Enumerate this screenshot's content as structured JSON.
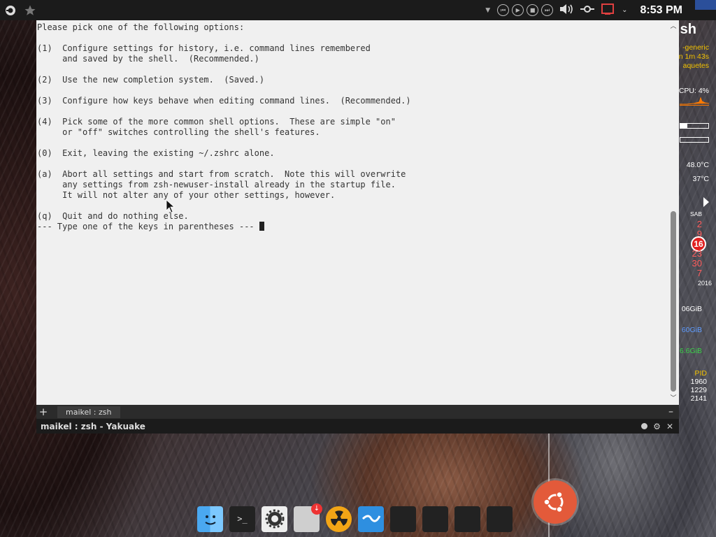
{
  "top_panel": {
    "clock": "8:53 PM",
    "icons_left": [
      "app-launcher-icon",
      "favorites-star-icon"
    ],
    "icons_right": [
      "dropdown-icon",
      "previous-track-icon",
      "play-icon",
      "stop-icon",
      "next-track-icon",
      "volume-icon",
      "network-icon",
      "notification-icon",
      "chevron-down-icon"
    ]
  },
  "terminal": {
    "lines": [
      "Please pick one of the following options:",
      "",
      "(1)  Configure settings for history, i.e. command lines remembered",
      "     and saved by the shell.  (Recommended.)",
      "",
      "(2)  Use the new completion system.  (Saved.)",
      "",
      "(3)  Configure how keys behave when editing command lines.  (Recommended.)",
      "",
      "(4)  Pick some of the more common shell options.  These are simple \"on\"",
      "     or \"off\" switches controlling the shell's features.",
      "",
      "(0)  Exit, leaving the existing ~/.zshrc alone.",
      "",
      "(a)  Abort all settings and start from scratch.  Note this will overwrite",
      "     any settings from zsh-newuser-install already in the startup file.",
      "     It will not alter any of your other settings, however.",
      "",
      "(q)  Quit and do nothing else.",
      "--- Type one of the keys in parentheses --- "
    ]
  },
  "tabbar": {
    "add_label": "+",
    "tab_label": "maikel : zsh",
    "minimize_label": "–"
  },
  "titlebar": {
    "title": "maikel : zsh - Yakuake"
  },
  "conky": {
    "host": "sh",
    "kernel": "-generic",
    "uptime": "n 1m 43s",
    "packages": "aquetes",
    "cpu": "CPU: 4%",
    "temp1": "48.0°C",
    "temp2": "37°C",
    "day": "SAB",
    "dates": [
      "2",
      "9",
      "16",
      "23",
      "30",
      "7"
    ],
    "year": "2016",
    "mem1": "06GiB",
    "mem2": "60GiB",
    "mem3": "6.6GiB",
    "pid_header": "PID",
    "pids": [
      "1960",
      "1229",
      "2141"
    ]
  },
  "dock": {
    "apps": [
      "finder-icon",
      "terminal-icon",
      "settings-icon",
      "downloads-icon",
      "radiation-icon",
      "mail-icon",
      "apps-grid-icon",
      "media-grid-icon",
      "browsers-grid-icon",
      "tools-grid-icon"
    ]
  },
  "colors": {
    "terminal_bg": "#f0f0f0",
    "ubuntu_orange": "#e35a3a",
    "conky_yellow": "#f3c200",
    "conky_red": "#ff5d5d"
  }
}
